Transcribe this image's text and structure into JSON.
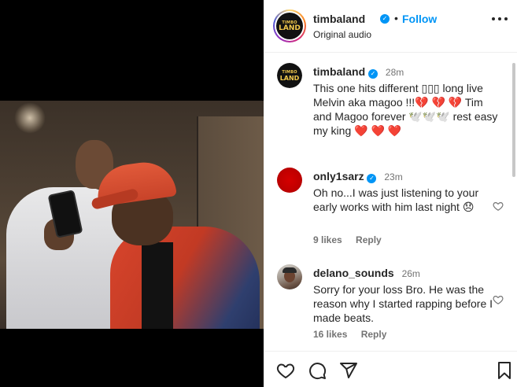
{
  "post": {
    "username": "timbaland",
    "follow_label": "Follow",
    "separator": "•",
    "audio_label": "Original audio",
    "logo_text_top": "TIMBO",
    "logo_text_bottom": "LAND",
    "verified_glyph": "✓"
  },
  "caption": {
    "username": "timbaland",
    "time": "28m",
    "text": "This one hits different ▯▯▯ long live Melvin aka magoo !!!💔 💔 💔 Tim and Magoo forever 🕊️🕊️🕊️ rest easy my king ❤️ ❤️ ❤️"
  },
  "comments": [
    {
      "username": "only1sarz",
      "verified": true,
      "time": "23m",
      "text": "Oh no...I was just listening to your early works with him last night 😞",
      "likes": "9 likes",
      "reply_label": "Reply",
      "avatar_color": "#c80000"
    },
    {
      "username": "delano_sounds",
      "verified": false,
      "time": "26m",
      "text": "Sorry for your loss Bro. He was the reason why I started rapping before I made beats.",
      "likes": "16 likes",
      "reply_label": "Reply"
    }
  ],
  "actions": {
    "like_icon": "heart-icon",
    "comment_icon": "comment-icon",
    "share_icon": "share-icon",
    "save_icon": "bookmark-icon"
  },
  "colors": {
    "accent": "#0095f6",
    "text": "#262626",
    "muted": "#737373",
    "logo_gold": "#f2c94c"
  }
}
